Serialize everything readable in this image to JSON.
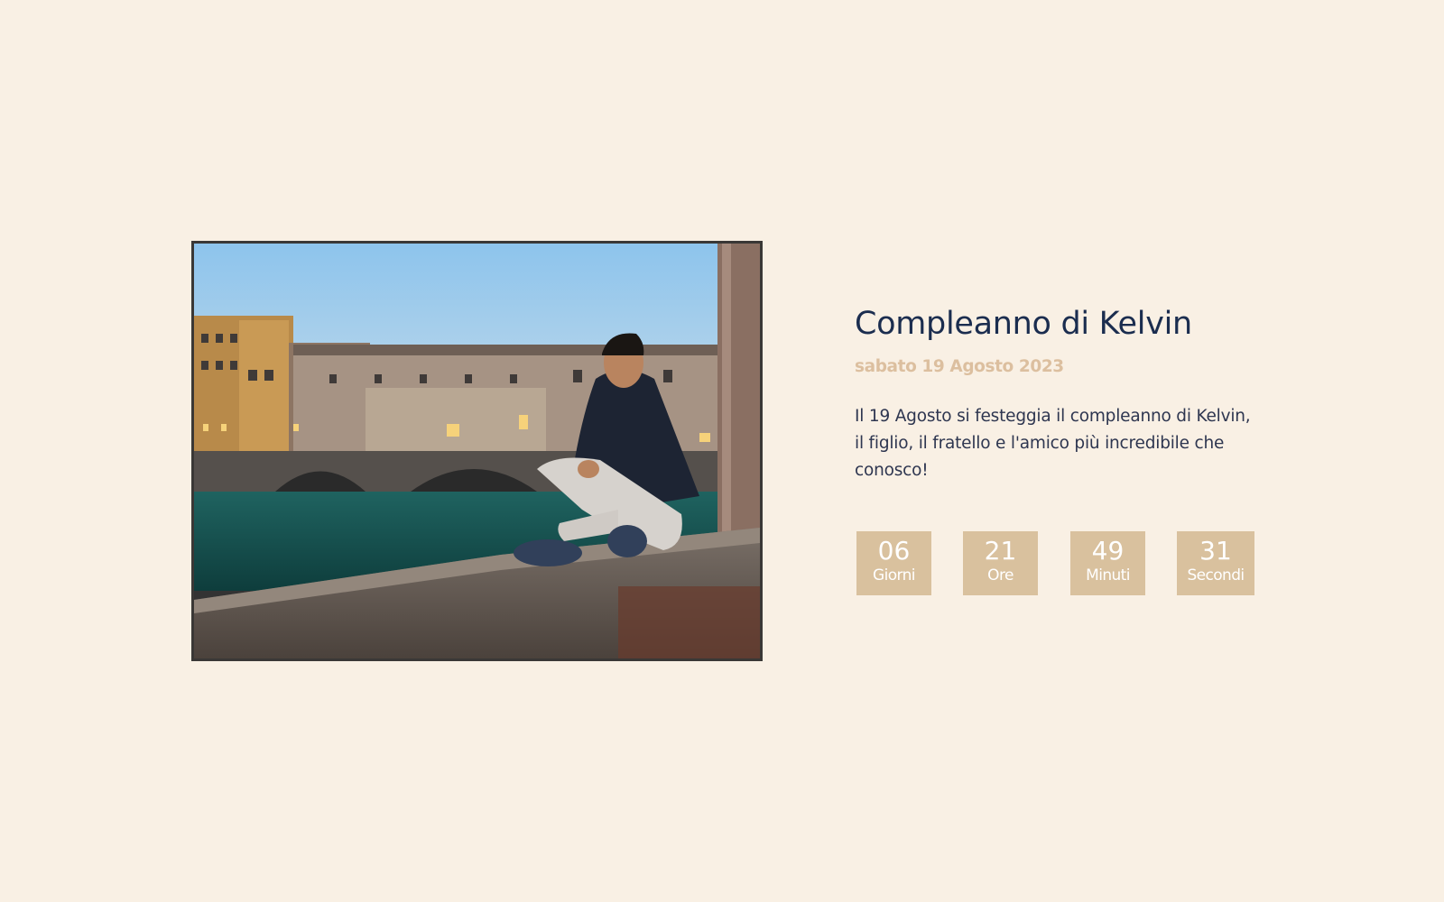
{
  "event": {
    "title": "Compleanno di Kelvin",
    "date": "sabato 19 Agosto 2023",
    "description": "Il 19 Agosto si festeggia il compleanno di Kelvin, il figlio, il fratello e l'amico più incredibile che conosco!"
  },
  "countdown": {
    "days": {
      "value": "06",
      "label": "Giorni"
    },
    "hours": {
      "value": "21",
      "label": "Ore"
    },
    "minutes": {
      "value": "49",
      "label": "Minuti"
    },
    "seconds": {
      "value": "31",
      "label": "Secondi"
    }
  },
  "colors": {
    "background": "#f9f0e4",
    "title": "#1b2d4f",
    "accent": "#d9c19e",
    "text": "#2e3650"
  }
}
